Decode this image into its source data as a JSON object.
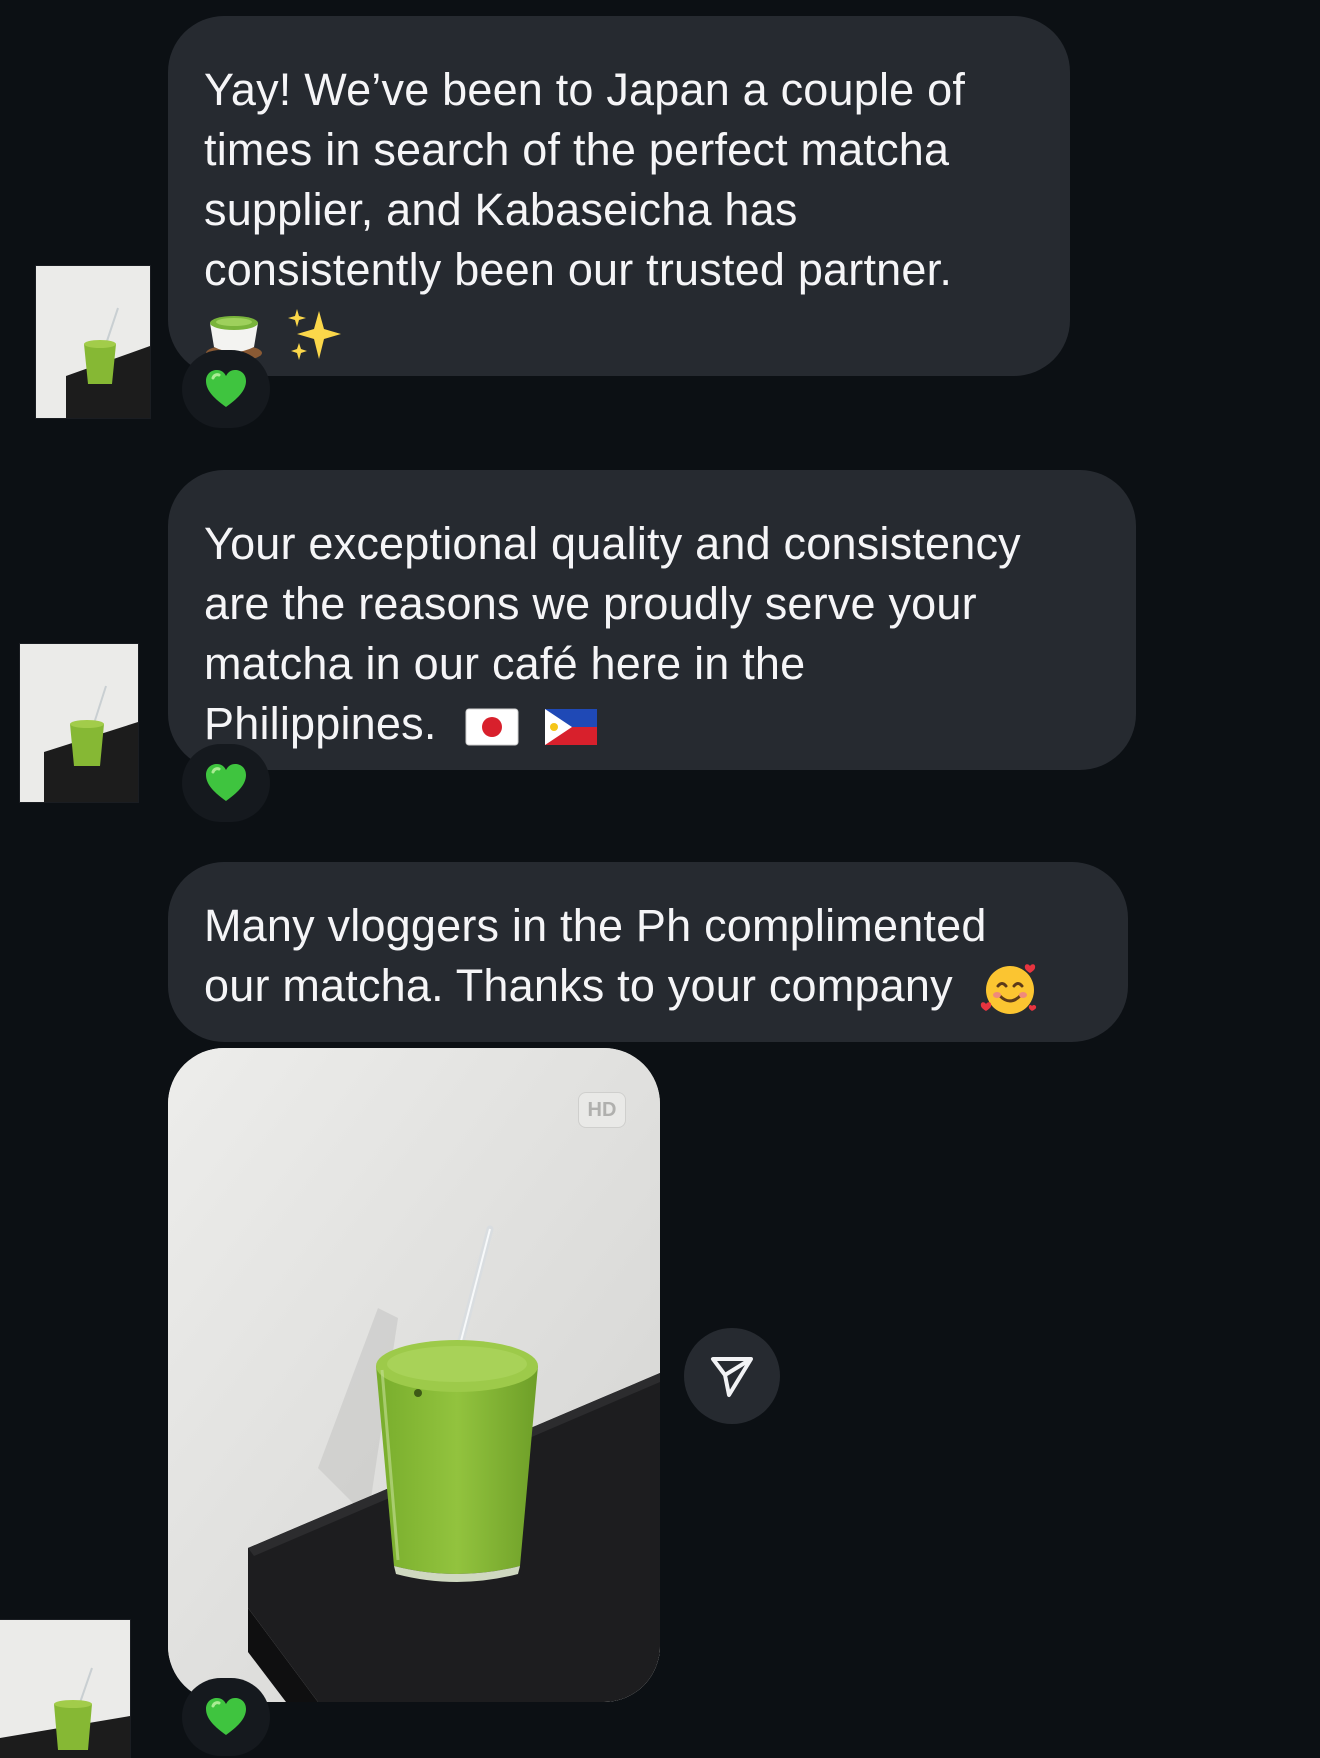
{
  "messages": [
    {
      "lines": [
        "Yay! We’ve been to Japan a couple of",
        "times in search of the perfect matcha",
        "supplier, and Kabaseicha has",
        "consistently been our trusted partner."
      ],
      "emojis": [
        "teacup-emoji",
        "sparkles-emoji"
      ],
      "reaction": "green-heart"
    },
    {
      "lines": [
        "Your exceptional quality and consistency",
        "are the reasons we proudly serve your",
        "matcha in our café here in the",
        "Philippines."
      ],
      "emojis": [
        "japan-flag-emoji",
        "philippines-flag-emoji"
      ],
      "reaction": "green-heart"
    },
    {
      "lines": [
        "Many vloggers in the Ph complimented",
        "our matcha. Thanks to your company"
      ],
      "emojis": [
        "smiling-face-with-hearts-emoji"
      ],
      "reaction": null
    }
  ],
  "photo_message": {
    "badge": "HD",
    "share_icon": "send-icon",
    "reaction": "green-heart"
  },
  "colors": {
    "background": "#0c1014",
    "bubble": "#262a30",
    "reaction_bg": "#15191e",
    "heart": "#3fc43f",
    "matcha": "#8dbf3a"
  }
}
